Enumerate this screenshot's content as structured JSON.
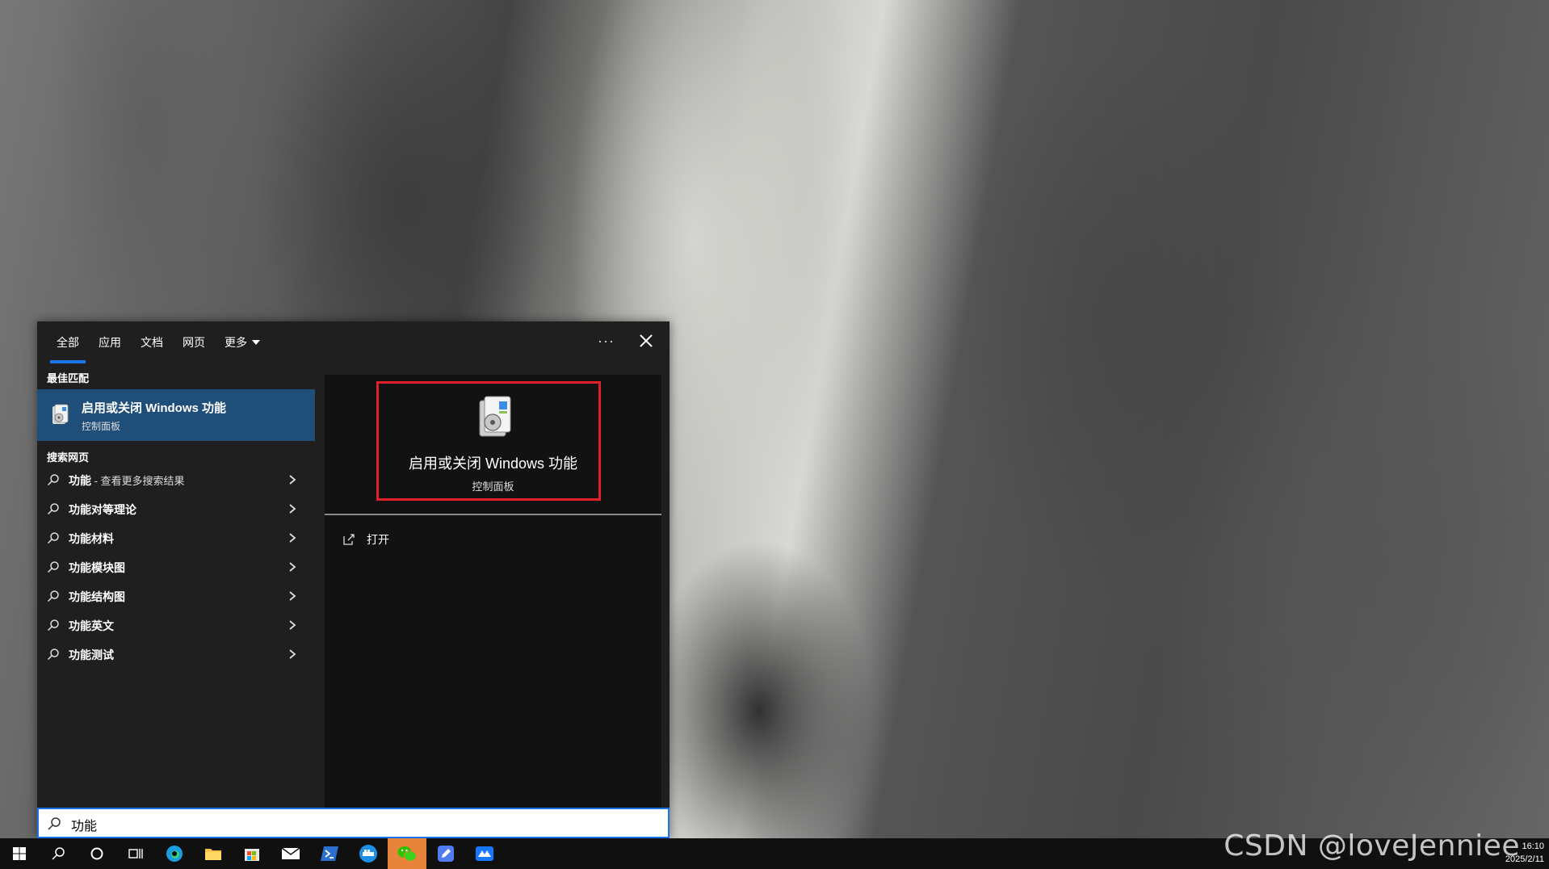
{
  "tabs": [
    {
      "label": "全部"
    },
    {
      "label": "应用"
    },
    {
      "label": "文档"
    },
    {
      "label": "网页"
    },
    {
      "label": "更多"
    }
  ],
  "more_options_label": "···",
  "best_match": {
    "header": "最佳匹配",
    "title": "启用或关闭 Windows 功能",
    "subtitle": "控制面板"
  },
  "web_search": {
    "header": "搜索网页",
    "items": [
      {
        "label": "功能",
        "suffix": " - 查看更多搜索结果"
      },
      {
        "label": "功能对等理论"
      },
      {
        "label": "功能材料"
      },
      {
        "label": "功能模块图"
      },
      {
        "label": "功能结构图"
      },
      {
        "label": "功能英文"
      },
      {
        "label": "功能测试"
      }
    ]
  },
  "preview": {
    "title": "启用或关闭 Windows 功能",
    "subtitle": "控制面板",
    "actions": [
      {
        "label": "打开"
      }
    ]
  },
  "search": {
    "value": "功能"
  },
  "clock": {
    "time": "16:10",
    "date": "2025/2/11"
  },
  "watermark": "CSDN @loveJenniee",
  "colors": {
    "accent": "#1a73e8",
    "highlight_border": "#e0202a",
    "selected_bg": "#1f4e79"
  }
}
